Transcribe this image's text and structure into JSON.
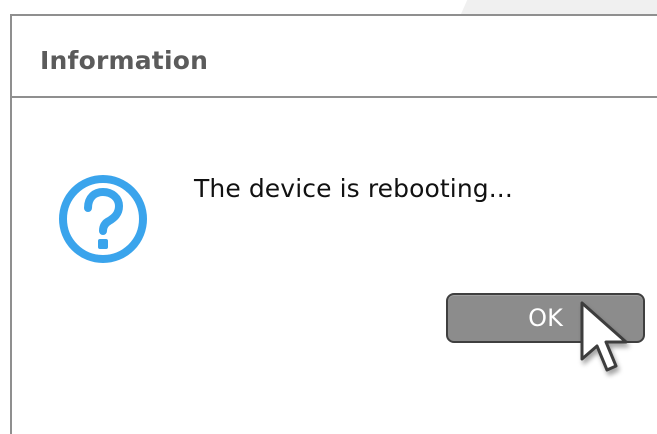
{
  "dialog": {
    "title": "Information",
    "message": "The device is rebooting...",
    "button_label": "OK"
  },
  "icons": {
    "main": "question-icon",
    "pointer": "mouse-pointer-icon"
  },
  "colors": {
    "icon_blue": "#3aa4ec",
    "title_gray": "#5b5b5b",
    "button_gray": "#8c8c8c",
    "border_gray": "#8f8f8f"
  }
}
